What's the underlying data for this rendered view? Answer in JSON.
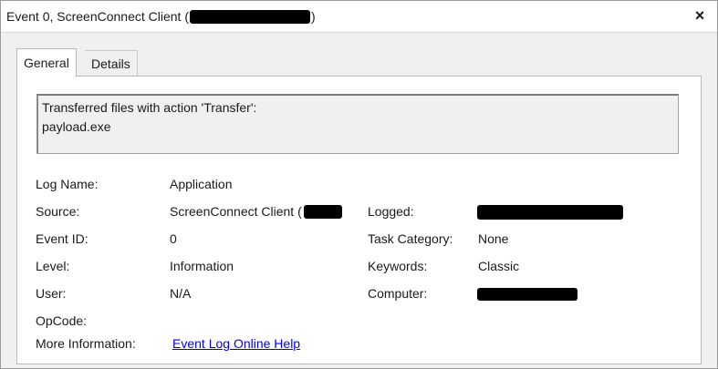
{
  "window": {
    "title_prefix": "Event 0, ScreenConnect Client (",
    "title_suffix": ")",
    "close_glyph": "×"
  },
  "tabs": [
    {
      "label": "General",
      "active": true
    },
    {
      "label": "Details",
      "active": false
    }
  ],
  "description": {
    "line1": "Transferred files with action 'Transfer':",
    "line2": "payload.exe"
  },
  "fields": {
    "log_name": {
      "label": "Log Name:",
      "value": "Application"
    },
    "source": {
      "label": "Source:",
      "value": "ScreenConnect Client ("
    },
    "event_id": {
      "label": "Event ID:",
      "value": "0"
    },
    "level": {
      "label": "Level:",
      "value": "Information"
    },
    "user": {
      "label": "User:",
      "value": "N/A"
    },
    "opcode": {
      "label": "OpCode:",
      "value": ""
    },
    "more_info": {
      "label": "More Information:",
      "link": "Event Log Online Help"
    },
    "logged": {
      "label": "Logged:",
      "value": ""
    },
    "task_category": {
      "label": "Task Category:",
      "value": "None"
    },
    "keywords": {
      "label": "Keywords:",
      "value": "Classic"
    },
    "computer": {
      "label": "Computer:",
      "value": ""
    }
  },
  "colors": {
    "link": "#0000ee",
    "pane_background": "#f0f0f0",
    "redaction": "#000000"
  }
}
